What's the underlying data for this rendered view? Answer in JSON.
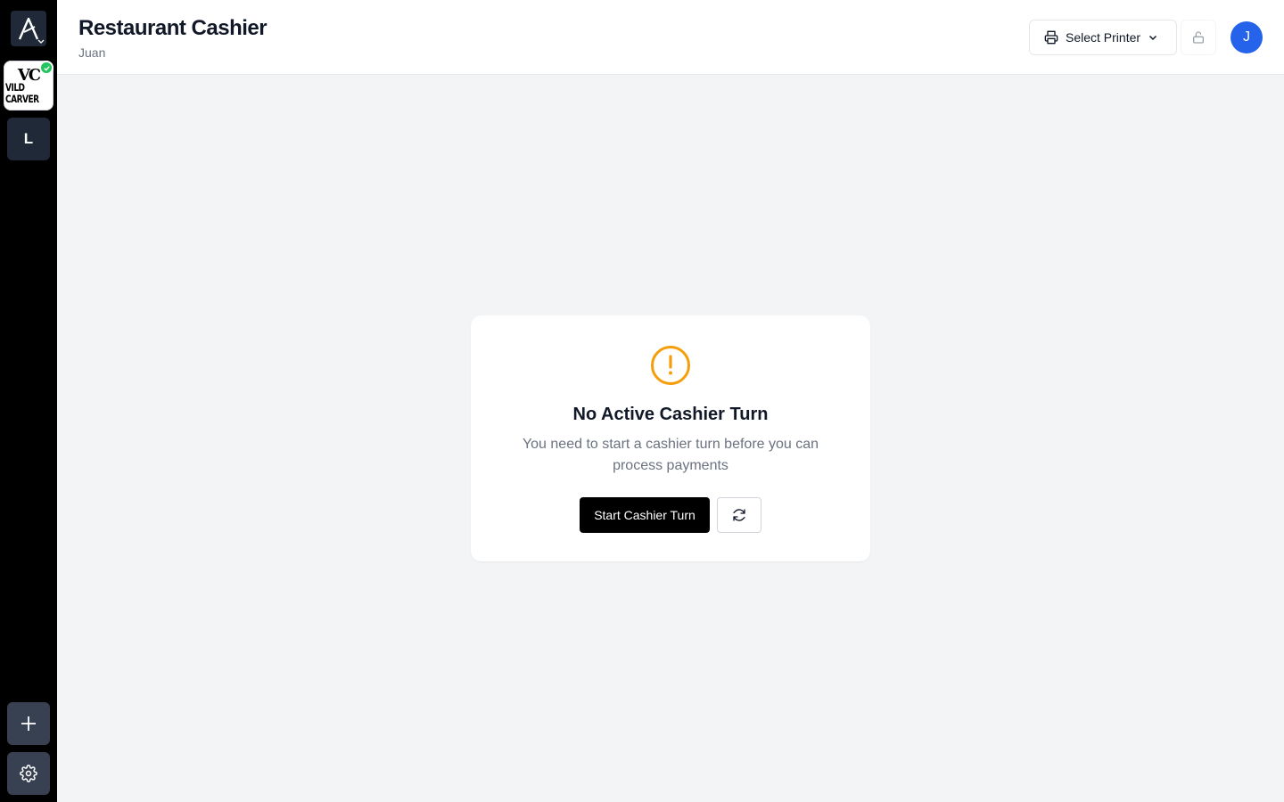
{
  "sidebar": {
    "brand": {
      "monogram": "VC",
      "name": "VILD CARVER",
      "tagline": ""
    },
    "workspace_initial": "L"
  },
  "header": {
    "title": "Restaurant Cashier",
    "user_name": "Juan",
    "printer_label": "Select Printer",
    "avatar_initial": "J"
  },
  "empty_state": {
    "title": "No Active Cashier Turn",
    "message": "You need to start a cashier turn before you can process payments",
    "primary_label": "Start Cashier Turn"
  },
  "colors": {
    "accent": "#2563eb",
    "warning": "#f59e0b",
    "success": "#22c55e",
    "rail": "#000000"
  },
  "icons": {
    "app_logo": "app-logo-icon",
    "printer": "printer-icon",
    "lock": "lock-icon",
    "warning": "warning-circle-icon",
    "refresh": "refresh-icon",
    "add": "plus-icon",
    "settings": "gear-icon"
  }
}
